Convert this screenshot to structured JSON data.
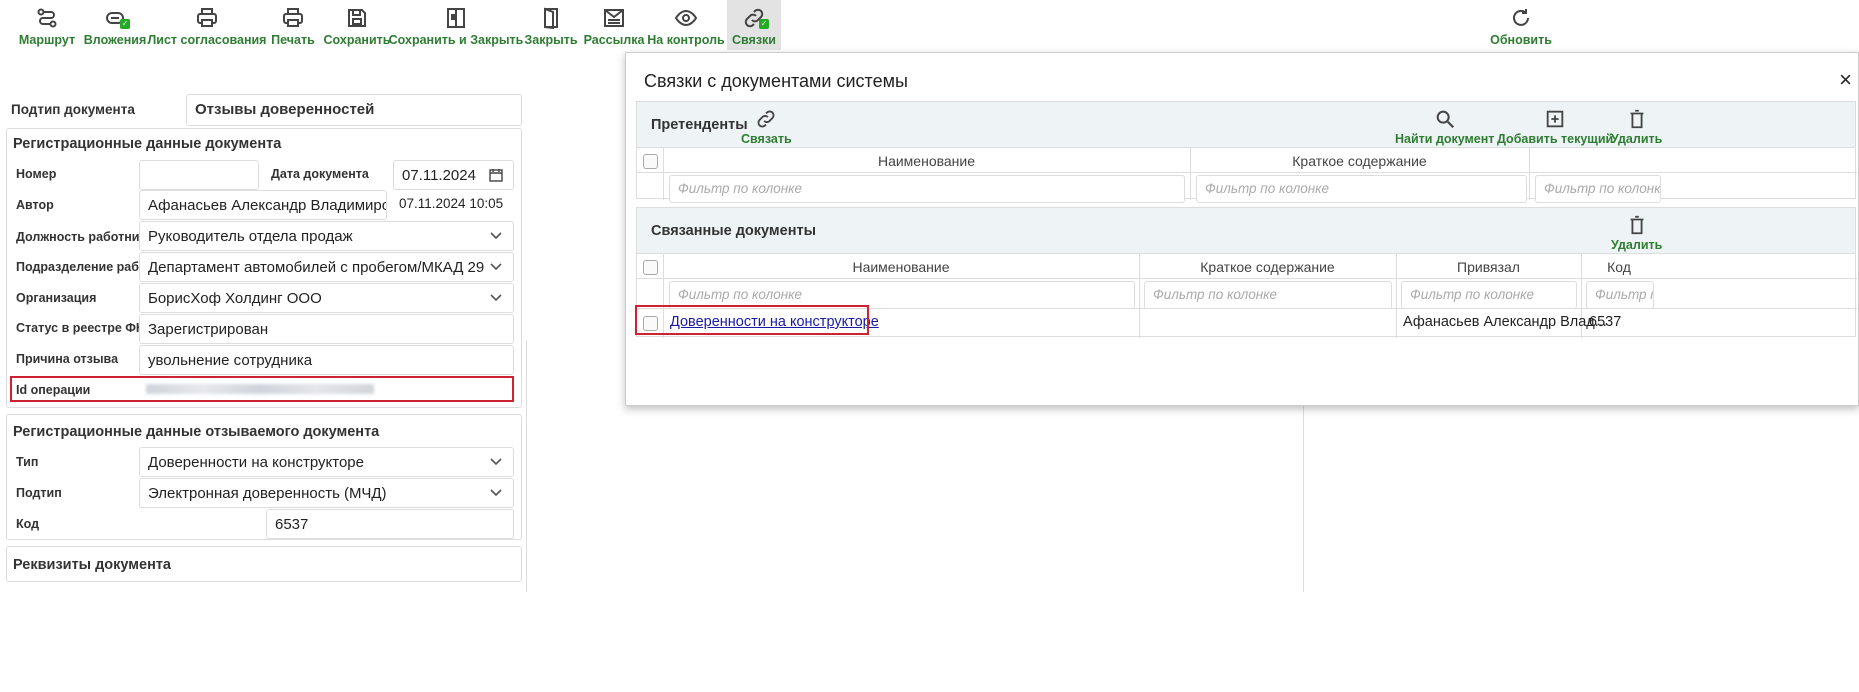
{
  "toolbar": {
    "buttons": [
      {
        "label": "Маршрут",
        "icon": "route-icon"
      },
      {
        "label": "Вложения",
        "icon": "paperclip-icon"
      },
      {
        "label": "Лист согласования",
        "icon": "print-icon"
      },
      {
        "label": "Печать",
        "icon": "print-icon"
      },
      {
        "label": "Сохранить",
        "icon": "save-icon"
      },
      {
        "label": "Сохранить и Закрыть",
        "icon": "save-close-icon"
      },
      {
        "label": "Закрыть",
        "icon": "door-icon"
      },
      {
        "label": "Рассылка",
        "icon": "mail-icon"
      },
      {
        "label": "На контроль",
        "icon": "eye-icon"
      },
      {
        "label": "Связки",
        "icon": "link-icon"
      },
      {
        "label": "Обновить",
        "icon": "refresh-icon"
      }
    ]
  },
  "form": {
    "subtype_label": "Подтип документа",
    "subtype_value": "Отзывы доверенностей",
    "reg_section": {
      "title": "Регистрационные данные документа",
      "number_label": "Номер",
      "number_value": "",
      "date_label": "Дата документа",
      "date_value": "07.11.2024",
      "author_label": "Автор",
      "author_value": "Афанасьев Александр Владимирович",
      "author_timestamp": "07.11.2024 10:05",
      "position_label": "Должность работника",
      "position_value": "Руководитель отдела продаж",
      "division_label": "Подразделение рабо...",
      "division_value": "Департамент автомобилей с пробегом/МКАД 29",
      "org_label": "Организация",
      "org_value": "БорисХоф Холдинг ООО",
      "fns_label": "Статус в реестре ФНС",
      "fns_value": "Зарегистрирован",
      "reason_label": "Причина отзыва",
      "reason_value": "увольнение сотрудника",
      "opid_label": "Id операции"
    },
    "revoked_section": {
      "title": "Регистрационные данные отзываемого документа",
      "type_label": "Тип",
      "type_value": "Доверенности на конструкторе",
      "subtype_label": "Подтип",
      "subtype_value": "Электронная доверенность (МЧД)",
      "code_label": "Код",
      "code_value": "6537"
    },
    "requisites_title": "Реквизиты документа"
  },
  "modal": {
    "title": "Связки с документами системы",
    "close": "×",
    "candidates": {
      "title": "Претенденты",
      "link_btn": "Связать",
      "find_btn": "Найти документ",
      "add_btn": "Добавить текущий",
      "delete_btn": "Удалить",
      "columns": [
        "Наименование",
        "Краткое содержание",
        ""
      ],
      "filter_placeholder": "Фильтр по колонке"
    },
    "linked": {
      "title": "Связанные документы",
      "delete_btn": "Удалить",
      "columns": [
        "Наименование",
        "Краткое содержание",
        "Привязал",
        "Код"
      ],
      "filter_placeholder": "Фильтр по колонке",
      "filter_short": "Фильтр по...",
      "rows": [
        {
          "name": "Доверенности на конструкторе",
          "summary": "",
          "linked_by": "Афанасьев Александр Влад...",
          "code": "6537"
        }
      ]
    }
  },
  "colors": {
    "accent_green": "#2e7d32",
    "highlight_red": "#cc2233",
    "link_blue": "#1a1aa6",
    "panel_bg": "#eef3f5"
  }
}
